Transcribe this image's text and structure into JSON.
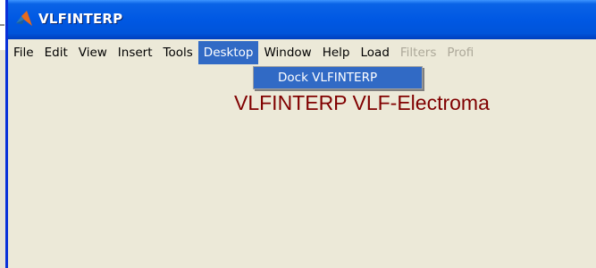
{
  "window": {
    "title": "VLFINTERP",
    "icon": "matlab-logo-icon"
  },
  "menubar": {
    "items": [
      {
        "label": "File",
        "state": "normal"
      },
      {
        "label": "Edit",
        "state": "normal"
      },
      {
        "label": "View",
        "state": "normal"
      },
      {
        "label": "Insert",
        "state": "normal"
      },
      {
        "label": "Tools",
        "state": "normal"
      },
      {
        "label": "Desktop",
        "state": "active"
      },
      {
        "label": "Window",
        "state": "normal"
      },
      {
        "label": "Help",
        "state": "normal"
      },
      {
        "label": "Load",
        "state": "normal"
      },
      {
        "label": "Filters",
        "state": "disabled"
      },
      {
        "label": "Profi",
        "state": "disabled"
      }
    ]
  },
  "dropdown": {
    "items": [
      {
        "label": "Dock VLFINTERP"
      }
    ]
  },
  "figure": {
    "title": "VLFINTERP VLF-Electroma",
    "title_color": "#800000"
  },
  "colors": {
    "titlebar": "#0058e3",
    "menu_highlight": "#316ac5",
    "background": "#ece9d8"
  }
}
